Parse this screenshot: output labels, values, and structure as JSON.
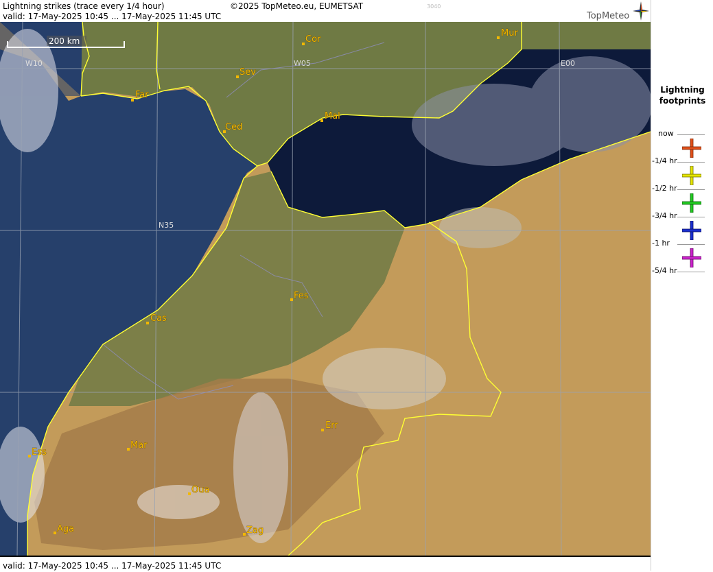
{
  "header": {
    "title": "Lightning strikes (trace every 1/4 hour)",
    "valid": "valid:  17-May-2025 10:45 ... 17-May-2025 11:45 UTC",
    "copyright": "©2025 TopMeteo.eu, EUMETSAT",
    "code": "3040",
    "brand": "TopMeteo"
  },
  "footer": {
    "valid": "valid:  17-May-2025 10:45 ... 17-May-2025 11:45 UTC"
  },
  "scale": {
    "label": "200 km"
  },
  "grid_labels": {
    "w10": "W10",
    "w05": "W05",
    "e00": "E00",
    "n35": "N35"
  },
  "cities": [
    {
      "name": "Cor"
    },
    {
      "name": "Mur"
    },
    {
      "name": "Sev"
    },
    {
      "name": "Far"
    },
    {
      "name": "Mal"
    },
    {
      "name": "Ced"
    },
    {
      "name": "Fes"
    },
    {
      "name": "Cas"
    },
    {
      "name": "Err"
    },
    {
      "name": "Ess"
    },
    {
      "name": "Mar"
    },
    {
      "name": "Oua"
    },
    {
      "name": "Aga"
    },
    {
      "name": "Zag"
    }
  ],
  "legend": {
    "title_line1": "Lightning",
    "title_line2": "footprints",
    "rows": [
      {
        "label": "now",
        "color": "#e0501a"
      },
      {
        "label": "-1/4 hr",
        "color": "#e6e600"
      },
      {
        "label": "-1/2 hr",
        "color": "#22cc22"
      },
      {
        "label": "-3/4 hr",
        "color": "#1a2fd0"
      },
      {
        "label": "-1 hr",
        "color": "#cc22cc"
      },
      {
        "label": "-5/4 hr",
        "color": ""
      }
    ]
  },
  "colors": {
    "sea": "#0d1a3a",
    "atlantic": "#26406b",
    "land": "#6f7a44",
    "desert": "#c9a05c",
    "border": "#ffff33"
  }
}
